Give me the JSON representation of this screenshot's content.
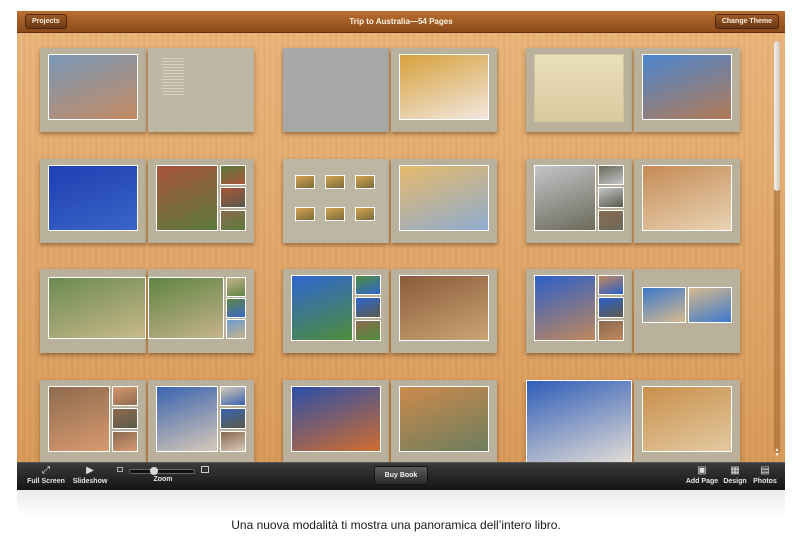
{
  "window": {
    "title": "Trip to Australia—54 Pages",
    "projects_label": "Projects",
    "change_theme_label": "Change Theme"
  },
  "book": {
    "zoom_fraction": 0.38,
    "scroll_fraction": 0.0,
    "spreads": [
      {
        "left": {
          "kind": "photos",
          "photos": [
            {
              "c1": "#7a99b8",
              "c2": "#c48a62"
            }
          ]
        },
        "right": {
          "kind": "text"
        }
      },
      {
        "left": {
          "kind": "blank"
        },
        "right": {
          "kind": "photos",
          "photos": [
            {
              "c1": "#d7a13c",
              "c2": "#f2e7df"
            }
          ]
        }
      },
      {
        "left": {
          "kind": "map"
        },
        "right": {
          "kind": "photos",
          "photos": [
            {
              "c1": "#4b86cf",
              "c2": "#b27a55"
            }
          ]
        }
      },
      {
        "left": {
          "kind": "photos",
          "photos": [
            {
              "c1": "#1d3fb2",
              "c2": "#3b64c8"
            }
          ]
        },
        "right": {
          "kind": "collage",
          "photos": [
            {
              "c1": "#a8553a",
              "c2": "#5b7a3a"
            }
          ]
        }
      },
      {
        "left": {
          "kind": "thumbs",
          "photos": [
            {
              "c1": "#d2a34e",
              "c2": "#7d6a3c"
            }
          ]
        },
        "right": {
          "kind": "photos",
          "photos": [
            {
              "c1": "#e6b96c",
              "c2": "#8eaccf"
            }
          ]
        }
      },
      {
        "left": {
          "kind": "collage",
          "photos": [
            {
              "c1": "#c3c4c8",
              "c2": "#6b6a5a"
            }
          ]
        },
        "right": {
          "kind": "photos",
          "photos": [
            {
              "c1": "#c58b55",
              "c2": "#e9d3b4"
            }
          ]
        }
      },
      {
        "left": {
          "kind": "wide",
          "photos": [
            {
              "c1": "#6b8a52",
              "c2": "#c9b98a"
            }
          ]
        },
        "right": {
          "kind": "collage-side",
          "photos": [
            {
              "c1": "#5f8444",
              "c2": "#c6b38a"
            }
          ]
        }
      },
      {
        "left": {
          "kind": "collage",
          "photos": [
            {
              "c1": "#2f66d0",
              "c2": "#4e8d3a"
            }
          ]
        },
        "right": {
          "kind": "photos",
          "photos": [
            {
              "c1": "#8b5b3a",
              "c2": "#caa574"
            }
          ]
        }
      },
      {
        "left": {
          "kind": "collage",
          "photos": [
            {
              "c1": "#2c5fc9",
              "c2": "#c0885c"
            }
          ]
        },
        "right": {
          "kind": "small",
          "photos": [
            {
              "c1": "#3d79cc",
              "c2": "#d6b98d"
            }
          ]
        }
      },
      {
        "left": {
          "kind": "collage",
          "photos": [
            {
              "c1": "#8e6b4e",
              "c2": "#d89a70"
            }
          ]
        },
        "right": {
          "kind": "collage",
          "photos": [
            {
              "c1": "#3a64b0",
              "c2": "#d7c8b8"
            }
          ]
        }
      },
      {
        "left": {
          "kind": "photos",
          "photos": [
            {
              "c1": "#2b4fa9",
              "c2": "#d06d2e"
            }
          ]
        },
        "right": {
          "kind": "photos",
          "photos": [
            {
              "c1": "#cc8a4c",
              "c2": "#6c7d5e"
            }
          ]
        }
      },
      {
        "left": {
          "kind": "full",
          "photos": [
            {
              "c1": "#2f5db8",
              "c2": "#e3ddd6"
            }
          ]
        },
        "right": {
          "kind": "photos",
          "photos": [
            {
              "c1": "#c9904c",
              "c2": "#e3c9a0"
            }
          ]
        }
      }
    ]
  },
  "toolbar": {
    "full_screen": "Full Screen",
    "slideshow": "Slideshow",
    "zoom": "Zoom",
    "buy_book": "Buy Book",
    "add_page": "Add Page",
    "design": "Design",
    "photos": "Photos",
    "icons": {
      "full_screen": "expand-icon",
      "slideshow": "play-icon",
      "add_page": "add-page-icon",
      "design": "design-icon",
      "photos": "photos-icon"
    }
  },
  "caption": "Una nuova modalità ti mostra una panoramica dell’intero libro."
}
